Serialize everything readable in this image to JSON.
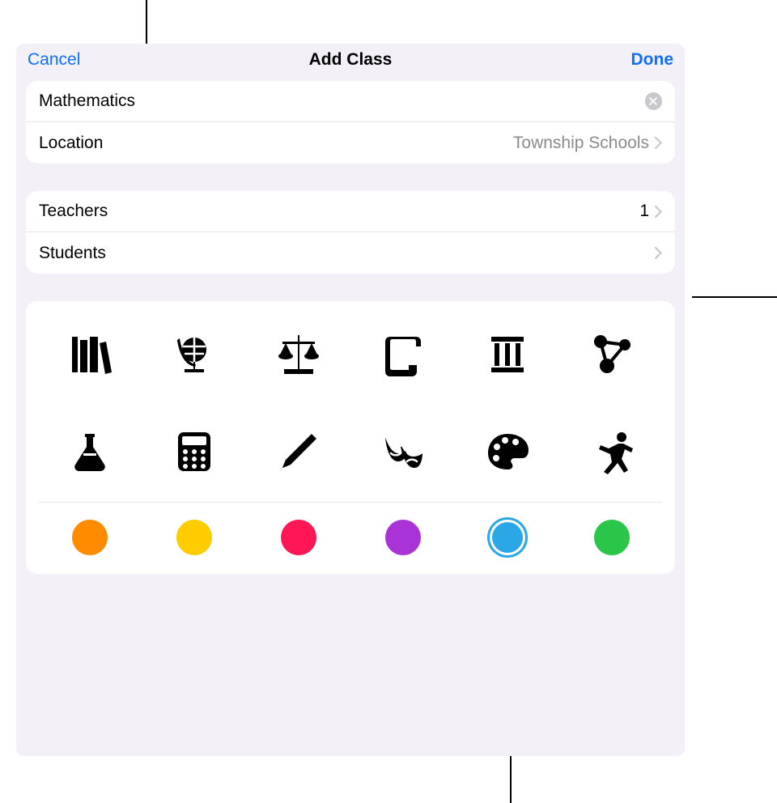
{
  "nav": {
    "cancel": "Cancel",
    "title": "Add Class",
    "done": "Done"
  },
  "form": {
    "class_name_value": "Mathematics",
    "location_label": "Location",
    "location_value": "Township Schools",
    "teachers_label": "Teachers",
    "teachers_count": "1",
    "students_label": "Students"
  },
  "icons": [
    {
      "id": "books-icon",
      "selected": false
    },
    {
      "id": "globe-icon",
      "selected": false
    },
    {
      "id": "scales-icon",
      "selected": false
    },
    {
      "id": "scroll-icon",
      "selected": false
    },
    {
      "id": "column-icon",
      "selected": false
    },
    {
      "id": "molecule-icon",
      "selected": false
    },
    {
      "id": "flask-icon",
      "selected": false
    },
    {
      "id": "calculator-icon",
      "selected": true
    },
    {
      "id": "pencil-icon",
      "selected": false
    },
    {
      "id": "theater-icon",
      "selected": false
    },
    {
      "id": "palette-icon",
      "selected": false
    },
    {
      "id": "runner-icon",
      "selected": false
    }
  ],
  "colors": [
    {
      "id": "orange",
      "hex": "#ff8c00",
      "selected": false
    },
    {
      "id": "yellow",
      "hex": "#ffcc00",
      "selected": false
    },
    {
      "id": "pink",
      "hex": "#ff1654",
      "selected": false
    },
    {
      "id": "purple",
      "hex": "#a933d6",
      "selected": false
    },
    {
      "id": "blue",
      "hex": "#2aa7e6",
      "selected": true
    },
    {
      "id": "green",
      "hex": "#29c64a",
      "selected": false
    }
  ],
  "accent": "#0f6fff",
  "selected_color": "#2aa7e6"
}
